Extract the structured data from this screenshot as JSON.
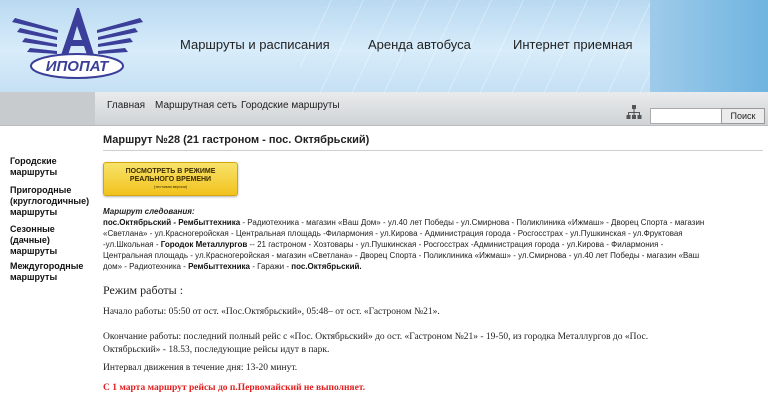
{
  "header": {
    "logo_text": "ИПОПАТ",
    "nav": [
      "Маршруты и расписания",
      "Аренда автобуса",
      "Интернет приемная"
    ]
  },
  "breadcrumb": [
    "Главная",
    "Маршрутная сеть",
    "Городские маршруты"
  ],
  "search": {
    "button_label": "Поиск",
    "value": ""
  },
  "sidebar": {
    "items": [
      {
        "line1": "Городские",
        "line2": "маршруты",
        "line3": ""
      },
      {
        "line1": "Пригородные",
        "line2": "(круглогодичные)",
        "line3": "маршруты"
      },
      {
        "line1": "Сезонные",
        "line2": "(дачные)",
        "line3": "маршруты"
      },
      {
        "line1": "Междугородные",
        "line2": "маршруты",
        "line3": ""
      }
    ]
  },
  "main": {
    "title": "Маршрут №28 (21 гастроном - пос. Октябрьский)",
    "realtime_button": {
      "line1": "ПОСМОТРЕТЬ В РЕЖИМЕ",
      "line2": "РЕАЛЬНОГО ВРЕМЕНИ",
      "line3": "(тестовая версия)"
    },
    "route_label": "Маршрут следования:",
    "route": {
      "l1_b": "пос.Октябрьский - Рембыттехника",
      "l1": " - Радиотехника - магазин «Ваш Дом» - ул.40 лет Победы - ул.Смирнова - Поликлиника «Ижмаш» - Дворец Спорта - магазин",
      "l2": "«Светлана» - ул.Красногеройская - Центральная площадь -Филармония - ул.Кирова - Администрация города - Росгосстрах - ул.Пушкинская - ул.Фруктовая",
      "l3a": "-ул.Школьная - ",
      "l3_b": "Городок Металлургов",
      "l3": " --  21 гастроном - Хозтовары - ул.Пушкинская - Росгосстрах -Администрация города - ул.Кирова - Филармония -",
      "l4": "Центральная площадь - ул.Красногеройская - магазин «Светлана» - Дворец Спорта - Поликлиника «Ижмаш» - ул.Смирнова - ул.40 лет Победы - магазин «Ваш",
      "l5a": "дом» - Радиотехника - ",
      "l5_b1": "Рембыттехника",
      "l5m": " - Гаражи - ",
      "l5_b2": "пос.Октябрьский."
    },
    "mode_heading": "Режим работы :",
    "start": "Начало работы: 05:50 от ост. «Пос.Октябрьский», 05:48– от ост. «Гастроном №21».",
    "end_l1": "Окончание работы: последний полный рейс с «Пос. Октябрьский» до ост. «Гастроном №21» - 19-50,  из городка Металлургов до «Пос.",
    "end_l2": "Октябрьский» - 18.53, последующие рейсы идут в парк.",
    "interval": "Интервал движения в течение дня: 13-20 минут.",
    "warning": "С 1 марта маршрут рейсы до п.Первомайский не выполняет."
  },
  "colors": {
    "warning": "#e31e1e",
    "header_sky": "#c9e1f4",
    "logo": "#3b3f9a"
  }
}
